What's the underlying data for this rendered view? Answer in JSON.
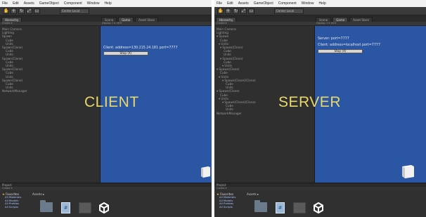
{
  "menu": [
    "File",
    "Edit",
    "Assets",
    "GameObject",
    "Component",
    "Window",
    "Help"
  ],
  "panes": [
    {
      "id": "left",
      "toolbar": {
        "layers_label": "Center  Local"
      },
      "hierarchy": {
        "tab_label": "Hierarchy",
        "create_label": "Create ▾",
        "items": [
          "Main Camera",
          "Lighting",
          "Spawn",
          "Cube",
          "Units",
          "Spawn(Clone)",
          "Cube",
          "Units",
          "Spawn(Clone)",
          "Cube",
          "Units",
          "Spawn(Clone)",
          "Cube",
          "Units",
          "Spawn(Clone)",
          "Cube",
          "Units",
          "NetworkManager"
        ]
      },
      "view_tabs": [
        "Scene",
        "Game",
        "Asset Store"
      ],
      "view_subbar": "Display 1  ▾   16:9",
      "game": {
        "lines": [
          "Client: address=130.215.24.181 port=7777"
        ],
        "button_label": "Stop (X)"
      },
      "overlay_label": "CLIENT",
      "project": {
        "tab_label": "Project",
        "create_label": "Create ▾",
        "favorites_label": "Favorites",
        "favorites": [
          "All Materials",
          "All Models",
          "All Prefabs",
          "All Scripts"
        ],
        "assets_label": "Assets ▸"
      }
    },
    {
      "id": "right",
      "toolbar": {
        "layers_label": "Center  Local"
      },
      "hierarchy": {
        "tab_label": "Hierarchy",
        "create_label": "Create ▾",
        "items": [
          "Main Camera",
          "Lighting",
          "▾ Spawn",
          "Cube",
          "▾ Units",
          "▾ Spawn(Clone)",
          "Cube",
          "Units",
          "▾ Spawn(Clone)",
          "Cube",
          "▾ Units",
          "▾ Spawn(Clone)",
          "Cube",
          "▾ Units",
          "▾ Spawn(Clone)(Clone)",
          "Cube",
          "Units",
          "▾ Spawn(Clone)",
          "Cube",
          "▾ Units",
          "▾ Spawn(Clone)(Clone)",
          "Cube",
          "Units",
          "NetworkManager"
        ]
      },
      "view_tabs": [
        "Scene",
        "Game",
        "Asset Store"
      ],
      "view_subbar": "Display 1  ▾   16:9",
      "game": {
        "lines": [
          "Server: port=7777",
          "Client: address=localhost port=7777"
        ],
        "button_label": "Stop (X)"
      },
      "overlay_label": "SERVER",
      "project": {
        "tab_label": "Project",
        "create_label": "Create ▾",
        "favorites_label": "Favorites",
        "favorites": [
          "All Materials",
          "All Models",
          "All Prefabs",
          "All Scripts"
        ],
        "assets_label": "Assets ▸"
      }
    }
  ],
  "colors": {
    "game_background": "#2a56a3",
    "overlay_text": "#e8d86a",
    "editor_dark": "#2e2e2e",
    "menubar": "#f1f1f1"
  }
}
